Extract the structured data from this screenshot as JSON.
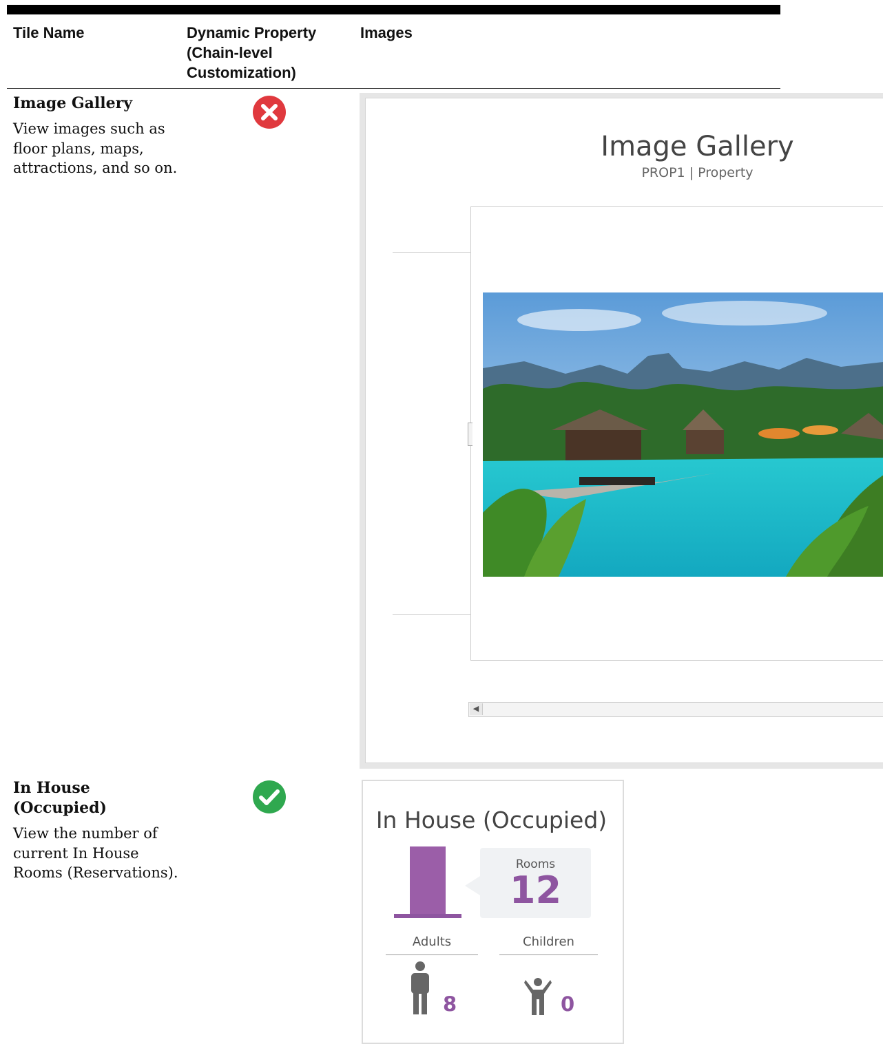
{
  "table": {
    "headers": {
      "tile_name": "Tile Name",
      "dynamic_property": "Dynamic Property (Chain-level Customization)",
      "images": "Images"
    },
    "rows": [
      {
        "title": "Image Gallery",
        "description": "View images such as floor plans, maps, attractions, and so on.",
        "dynamic_property_supported": false,
        "status_icon": "error-x-circle-icon"
      },
      {
        "title": "In House (Occupied)",
        "description": "View the number of current In House Rooms (Reservations).",
        "dynamic_property_supported": true,
        "status_icon": "check-circle-icon"
      }
    ]
  },
  "gallery_tile": {
    "title": "Image Gallery",
    "subtitle": "PROP1 | Property"
  },
  "in_house_tile": {
    "title": "In House (Occupied)",
    "rooms_label": "Rooms",
    "rooms_value": "12",
    "adults_label": "Adults",
    "adults_value": "8",
    "children_label": "Children",
    "children_value": "0"
  },
  "colors": {
    "error": "#e0393e",
    "success": "#2fa84f",
    "accent_purple": "#8e55a0",
    "icon_gray": "#666666"
  }
}
